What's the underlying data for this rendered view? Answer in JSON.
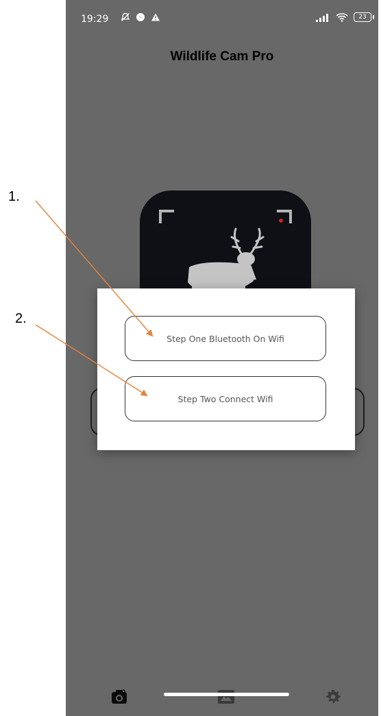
{
  "status_bar": {
    "time": "19:29",
    "battery": "23"
  },
  "app": {
    "title": "Wildlife Cam Pro"
  },
  "dialog": {
    "step_one_label": "Step One Bluetooth On Wifi",
    "step_two_label": "Step Two Connect Wifi"
  },
  "bottom_nav": {
    "items": [
      "camera-icon",
      "gallery-icon",
      "settings-icon"
    ]
  },
  "annotations": {
    "label_1": "1.",
    "label_2": "2.",
    "arrow_color": "#e8823a"
  },
  "colors": {
    "background": "#686868",
    "logo_bg": "#0e1015",
    "rec_dot": "#e02020"
  }
}
